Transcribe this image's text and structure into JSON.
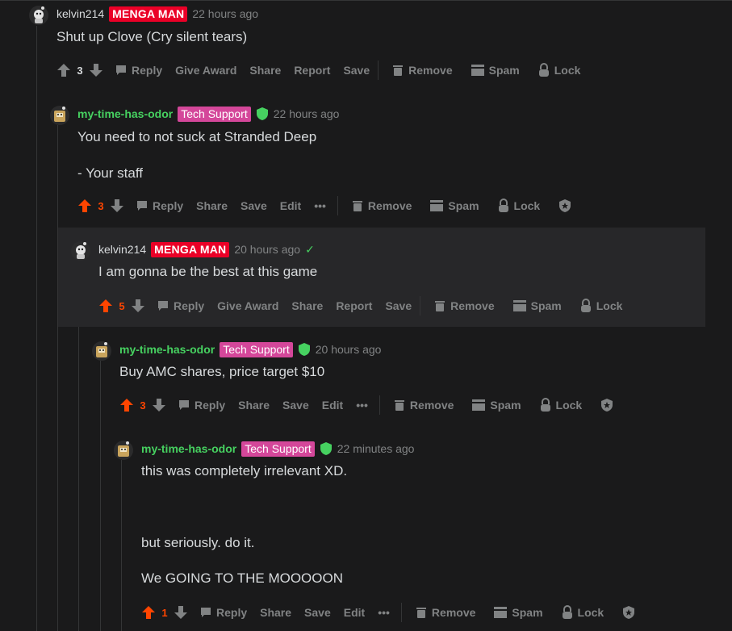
{
  "thread_color": "#343536",
  "mod_green": "#46d160",
  "upvote_orange": "#ff4500",
  "c1": {
    "username": "kelvin214",
    "flair": "MENGA MAN",
    "time": "22 hours ago",
    "lines": [
      "Shut up Clove (Cry silent tears)"
    ],
    "score": "3",
    "actions": {
      "reply": "Reply",
      "award": "Give Award",
      "share": "Share",
      "report": "Report",
      "save": "Save",
      "remove": "Remove",
      "spam": "Spam",
      "lock": "Lock"
    }
  },
  "c2": {
    "username": "my-time-has-odor",
    "flair": "Tech Support",
    "time": "22 hours ago",
    "lines": [
      "You need to not suck at Stranded Deep",
      "- Your staff"
    ],
    "score": "3",
    "actions": {
      "reply": "Reply",
      "share": "Share",
      "save": "Save",
      "edit": "Edit",
      "more": "•••",
      "remove": "Remove",
      "spam": "Spam",
      "lock": "Lock"
    }
  },
  "c3": {
    "username": "kelvin214",
    "flair": "MENGA MAN",
    "time": "20 hours ago",
    "check": "✓",
    "lines": [
      "I am gonna be the best at this game"
    ],
    "score": "5",
    "actions": {
      "reply": "Reply",
      "award": "Give Award",
      "share": "Share",
      "report": "Report",
      "save": "Save",
      "remove": "Remove",
      "spam": "Spam",
      "lock": "Lock"
    }
  },
  "c4": {
    "username": "my-time-has-odor",
    "flair": "Tech Support",
    "time": "20 hours ago",
    "lines": [
      "Buy AMC shares, price target $10"
    ],
    "score": "3",
    "actions": {
      "reply": "Reply",
      "share": "Share",
      "save": "Save",
      "edit": "Edit",
      "more": "•••",
      "remove": "Remove",
      "spam": "Spam",
      "lock": "Lock"
    }
  },
  "c5": {
    "username": "my-time-has-odor",
    "flair": "Tech Support",
    "time": "22 minutes ago",
    "lines": [
      "this was completely irrelevant XD.",
      "but seriously. do it.",
      "We GOING TO THE MOOOOON"
    ],
    "score": "1",
    "actions": {
      "reply": "Reply",
      "share": "Share",
      "save": "Save",
      "edit": "Edit",
      "more": "•••",
      "remove": "Remove",
      "spam": "Spam",
      "lock": "Lock"
    }
  }
}
